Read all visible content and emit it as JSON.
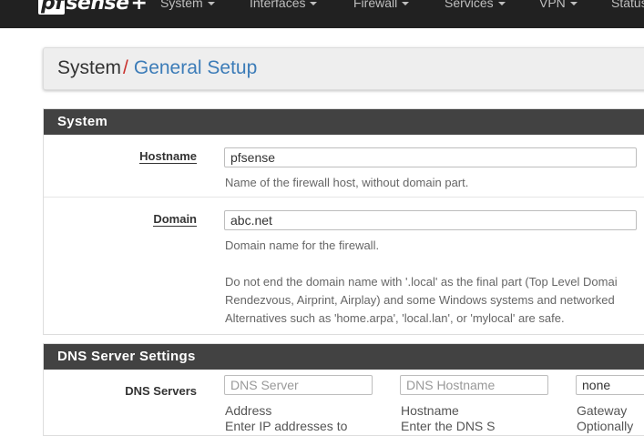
{
  "navbar": {
    "logo_pf": "pf",
    "logo_sense": "sense",
    "logo_plus": "+",
    "items": [
      {
        "label": "System"
      },
      {
        "label": "Interfaces"
      },
      {
        "label": "Firewall"
      },
      {
        "label": "Services"
      },
      {
        "label": "VPN"
      },
      {
        "label": "Status"
      }
    ]
  },
  "breadcrumb": {
    "root": "System",
    "separator": "/",
    "current": "General Setup"
  },
  "system_panel": {
    "heading": "System",
    "hostname": {
      "label": "Hostname",
      "value": "pfsense",
      "help": "Name of the firewall host, without domain part."
    },
    "domain": {
      "label": "Domain",
      "value": "abc.net",
      "help1": "Domain name for the firewall.",
      "help2": "Do not end the domain name with '.local' as the final part (Top Level Domai",
      "help3": "Rendezvous, Airprint, Airplay) and some Windows systems and networked",
      "help4": "Alternatives such as 'home.arpa', 'local.lan', or 'mylocal' are safe."
    }
  },
  "dns_panel": {
    "heading": "DNS Server Settings",
    "label": "DNS Servers",
    "server_placeholder": "DNS Server",
    "hostname_placeholder": "DNS Hostname",
    "gateway_value": "none",
    "sub_address": "Address",
    "sub_hostname": "Hostname",
    "sub_gateway": "Gateway",
    "hint_address": "Enter IP addresses to",
    "hint_hostname": "Enter the DNS S",
    "hint_gateway": "Optionally"
  },
  "colors": {
    "navbar_bg": "#212121",
    "panel_heading_bg": "#424242",
    "breadcrumb_separator": "#c9302c",
    "breadcrumb_current": "#3c7cb8"
  }
}
